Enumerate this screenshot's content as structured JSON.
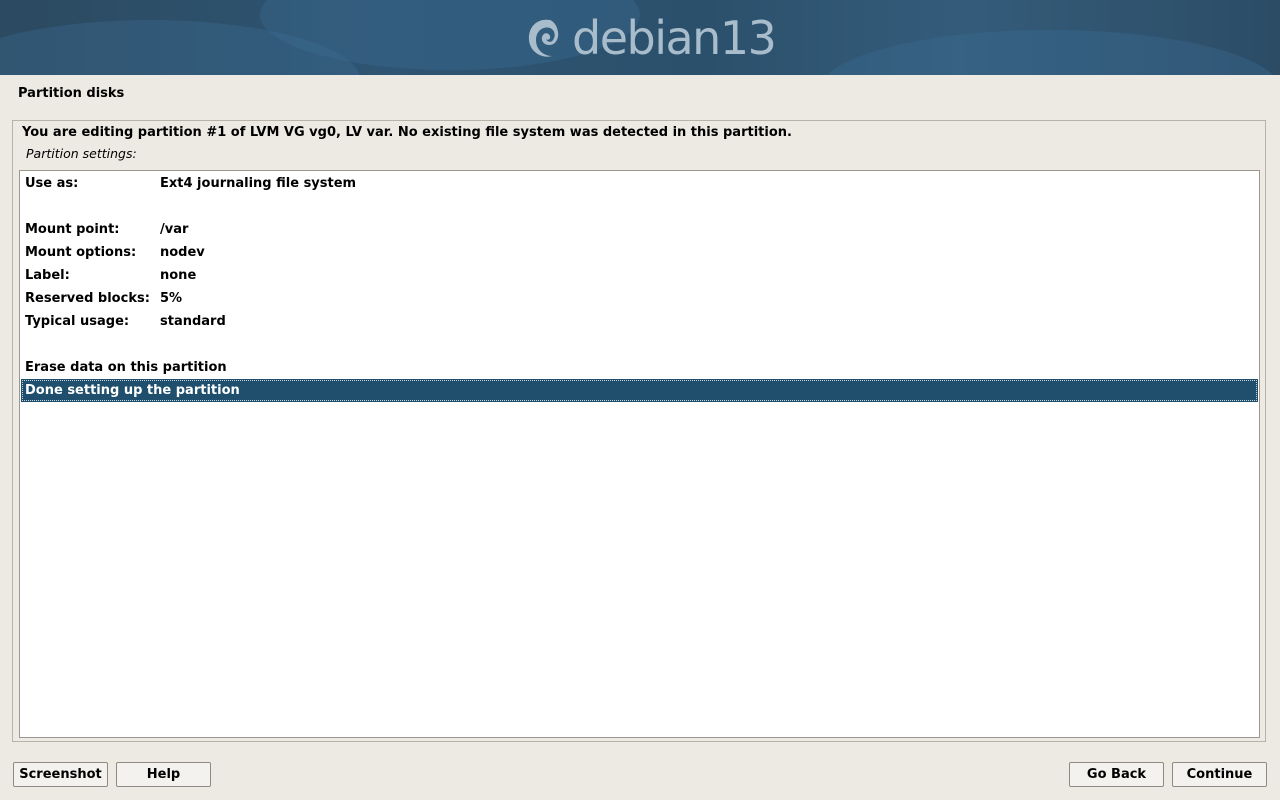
{
  "banner": {
    "logo_text": "debian13",
    "colors": {
      "banner_bg": "#2e5573",
      "logo_text": "#a9bccb"
    },
    "icon": "debian-swirl-icon"
  },
  "step_title": "Partition disks",
  "message": "You are editing partition #1 of LVM VG vg0, LV var. No existing file system was detected in this partition.",
  "subheading": "Partition settings:",
  "settings": [
    {
      "key": "Use as:",
      "value": "Ext4 journaling file system"
    },
    {
      "key": "Mount point:",
      "value": "/var"
    },
    {
      "key": "Mount options:",
      "value": "nodev"
    },
    {
      "key": "Label:",
      "value": "none"
    },
    {
      "key": "Reserved blocks:",
      "value": "5%"
    },
    {
      "key": "Typical usage:",
      "value": "standard"
    }
  ],
  "actions": [
    {
      "label": "Erase data on this partition"
    },
    {
      "label": "Done setting up the partition",
      "selected": true
    }
  ],
  "buttons": {
    "screenshot": "Screenshot",
    "help": "Help",
    "go_back": "Go Back",
    "continue": "Continue"
  },
  "colors": {
    "selection_bg": "#1f4f6d",
    "window_bg": "#edeae4"
  }
}
